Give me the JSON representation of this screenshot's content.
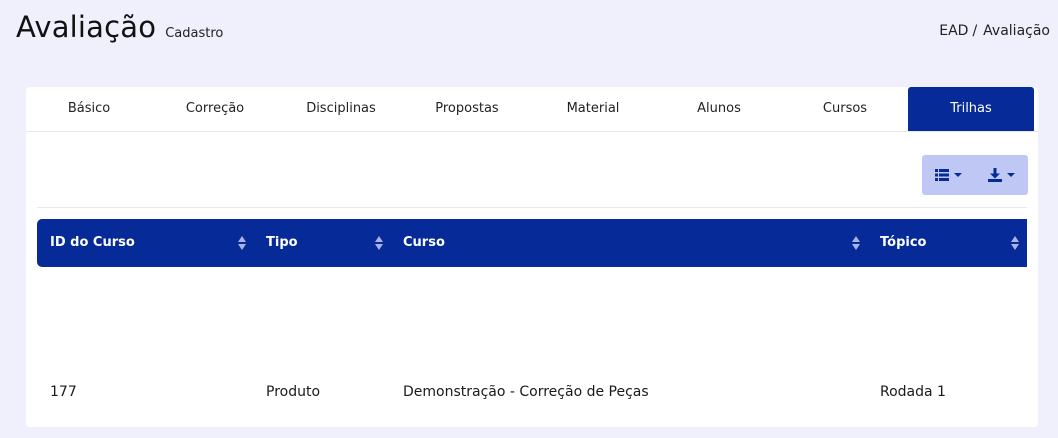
{
  "header": {
    "title": "Avaliação",
    "subtitle": "Cadastro"
  },
  "breadcrumb": {
    "items": [
      "EAD",
      "Avaliação"
    ],
    "separator": "/"
  },
  "tabs": [
    {
      "label": "Básico"
    },
    {
      "label": "Correção"
    },
    {
      "label": "Disciplinas"
    },
    {
      "label": "Propostas"
    },
    {
      "label": "Material"
    },
    {
      "label": "Alunos"
    },
    {
      "label": "Cursos"
    },
    {
      "label": "Trilhas"
    }
  ],
  "active_tab": "Trilhas",
  "toolbar": {
    "columns_icon": "list-icon",
    "export_icon": "download-icon"
  },
  "table": {
    "columns": [
      "ID do Curso",
      "Tipo",
      "Curso",
      "Tópico"
    ],
    "rows": [
      [
        "177",
        "Produto",
        "Demonstração - Correção de Peças",
        "Rodada 1"
      ]
    ]
  },
  "colors": {
    "primary": "#062a97",
    "background": "#eff0fb",
    "toolbar_bg": "#bfc8f5"
  }
}
